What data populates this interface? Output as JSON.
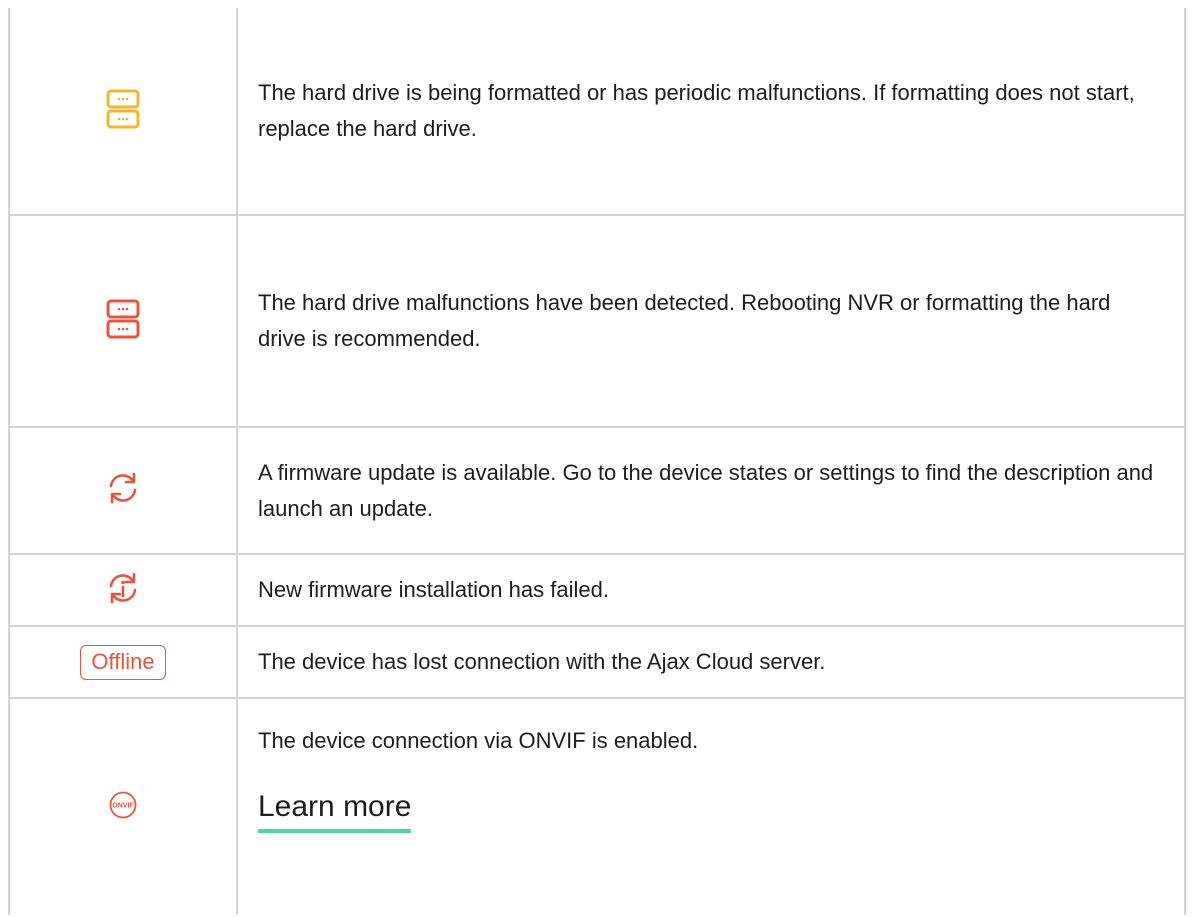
{
  "rows": [
    {
      "icon": "hdd-warning-icon",
      "icon_color": "#f5b533",
      "text": "The hard drive is being formatted or has periodic malfunctions. If formatting does not start, replace the hard drive."
    },
    {
      "icon": "hdd-error-icon",
      "icon_color": "#e8553f",
      "text": "The hard drive malfunctions have been detected. Rebooting NVR or formatting the hard drive is recommended."
    },
    {
      "icon": "refresh-icon",
      "icon_color": "#e8553f",
      "text": "A firmware update is available. Go to the device states or settings to find the description and launch an update."
    },
    {
      "icon": "update-failed-icon",
      "icon_color": "#e8553f",
      "text": "New firmware installation has failed."
    },
    {
      "icon": "offline-badge",
      "icon_color": "#e8553f",
      "badge_label": "Offline",
      "text": "The device has lost connection with the Ajax Cloud server."
    },
    {
      "icon": "onvif-icon",
      "icon_color": "#e8553f",
      "badge_label": "ONVIF",
      "text": "The device connection via ONVIF is enabled.",
      "link_label": "Learn more"
    }
  ],
  "colors": {
    "border": "#d4d4d4",
    "link_underline": "#4fd99a",
    "text": "#1d1d1d"
  }
}
